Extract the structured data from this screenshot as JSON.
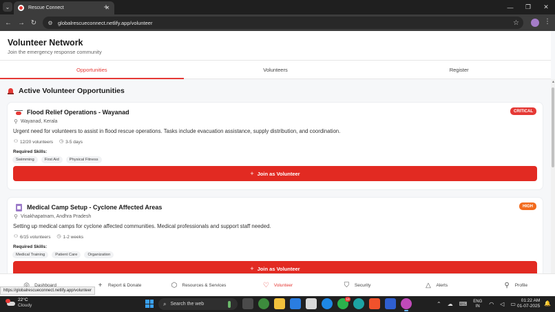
{
  "browser": {
    "tab_title": "Rescue Connect",
    "tab_close": "✕",
    "new_tab": "+",
    "url": "globalrescueconnect.netlify.app/volunteer",
    "status_url": "https://globalrescueconnect.netlify.app/volunteer"
  },
  "header": {
    "title": "Volunteer Network",
    "subtitle": "Join the emergency response community"
  },
  "tabs": [
    {
      "label": "Opportunities",
      "active": true
    },
    {
      "label": "Volunteers",
      "active": false
    },
    {
      "label": "Register",
      "active": false
    }
  ],
  "section": {
    "title": "Active Volunteer Opportunities",
    "icon": "siren-icon"
  },
  "opportunities": [
    {
      "title": "Flood Relief Operations - Wayanad",
      "icon": "helicopter-icon",
      "badge": "CRITICAL",
      "location": "Wayanad, Kerala",
      "description": "Urgent need for volunteers to assist in flood rescue operations. Tasks include evacuation assistance, supply distribution, and coordination.",
      "volunteers": "12/20 volunteers",
      "duration": "3-5 days",
      "skills_label": "Required Skills:",
      "skills": [
        "Swimming",
        "First Aid",
        "Physical Fitness"
      ],
      "button": "Join as Volunteer"
    },
    {
      "title": "Medical Camp Setup - Cyclone Affected Areas",
      "icon": "clipboard-icon",
      "badge": "HIGH",
      "location": "Visakhapatnam, Andhra Pradesh",
      "description": "Setting up medical camps for cyclone affected communities. Medical professionals and support staff needed.",
      "volunteers": "6/15 volunteers",
      "duration": "1-2 weeks",
      "skills_label": "Required Skills:",
      "skills": [
        "Medical Training",
        "Patient Care",
        "Organization"
      ],
      "button": "Join as Volunteer"
    }
  ],
  "bottom_nav": [
    {
      "label": "Dashboard",
      "icon": "dashboard-icon",
      "glyph": "◎"
    },
    {
      "label": "Report & Donate",
      "icon": "plus-icon",
      "glyph": "+"
    },
    {
      "label": "Resources & Services",
      "icon": "package-icon",
      "glyph": "⬡"
    },
    {
      "label": "Volunteer",
      "icon": "heart-icon",
      "glyph": "♡"
    },
    {
      "label": "Security",
      "icon": "shield-icon",
      "glyph": "⛉"
    },
    {
      "label": "Alerts",
      "icon": "warning-icon",
      "glyph": "△"
    },
    {
      "label": "Profile",
      "icon": "user-icon",
      "glyph": "⚲"
    }
  ],
  "taskbar": {
    "temperature": "22°C",
    "condition": "Cloudy",
    "search_placeholder": "Search the web",
    "lang_top": "ENG",
    "lang_bottom": "IN",
    "time": "01:22 AM",
    "date": "01-07-2025",
    "whatsapp_badge": "10"
  },
  "colors": {
    "accent": "#e53935",
    "critical": "#e53935",
    "high": "#f26b1d",
    "button": "#e22a22"
  }
}
